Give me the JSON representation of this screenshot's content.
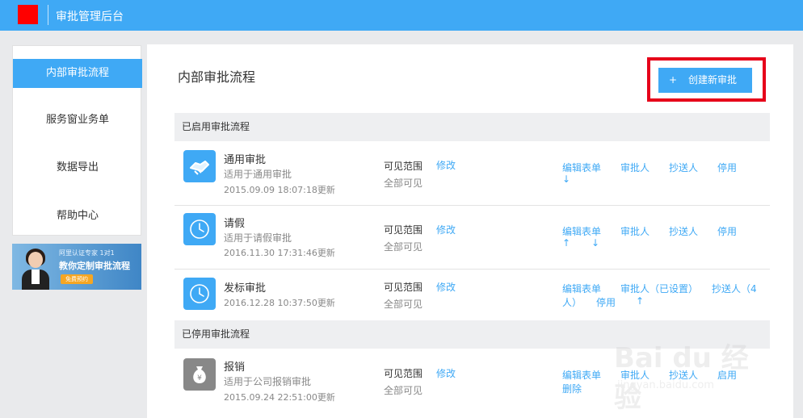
{
  "header": {
    "title": "审批管理后台",
    "logo_color": "#ff0000",
    "bar_color": "#3fa9f5"
  },
  "sidebar": {
    "items": [
      {
        "label": "内部审批流程",
        "active": true
      },
      {
        "label": "服务窗业务单"
      },
      {
        "label": "数据导出"
      },
      {
        "label": "帮助中心"
      }
    ]
  },
  "banner": {
    "line1": "阿里认证专家 1对1",
    "line2": "教你定制审批流程",
    "button": "免费预约"
  },
  "main": {
    "title": "内部审批流程",
    "create_button": {
      "icon": "+",
      "label": "创建新审批"
    },
    "enabled_section": "已启用审批流程",
    "disabled_section": "已停用审批流程"
  },
  "flows": [
    {
      "name": "通用审批",
      "desc": "适用于通用审批",
      "date": "2015.09.09 18:07:18更新",
      "icon": "handshake-icon",
      "vis_label": "可见范围",
      "vis_value": "全部可见",
      "modify": "修改",
      "actions": {
        "edit_form": "编辑表单",
        "approver": "审批人",
        "cc": "抄送人",
        "disable": "停用",
        "down": "↓"
      }
    },
    {
      "name": "请假",
      "desc": "适用于请假审批",
      "date": "2016.11.30 17:31:46更新",
      "icon": "clock-icon",
      "vis_label": "可见范围",
      "vis_value": "全部可见",
      "modify": "修改",
      "actions": {
        "edit_form": "编辑表单",
        "approver": "审批人",
        "cc": "抄送人",
        "disable": "停用",
        "up": "↑",
        "down": "↓"
      }
    },
    {
      "name": "发标审批",
      "desc": "",
      "date": "2016.12.28 10:37:50更新",
      "icon": "clock-icon",
      "vis_label": "可见范围",
      "vis_value": "全部可见",
      "modify": "修改",
      "actions": {
        "edit_form": "编辑表单",
        "approver": "审批人（已设置）",
        "cc": "抄送人（4",
        "cc2": "人）",
        "disable": "停用",
        "up": "↑"
      }
    },
    {
      "name": "报销",
      "desc": "适用于公司报销审批",
      "date": "2015.09.24 22:51:00更新",
      "icon": "money-bag-icon",
      "vis_label": "可见范围",
      "vis_value": "全部可见",
      "modify": "修改",
      "actions": {
        "edit_form": "编辑表单",
        "approver": "审批人",
        "cc": "抄送人",
        "enable": "启用",
        "delete": "删除"
      }
    }
  ],
  "watermark": {
    "text": "Bai du 经验",
    "sub": "jingyan.baidu.com"
  }
}
